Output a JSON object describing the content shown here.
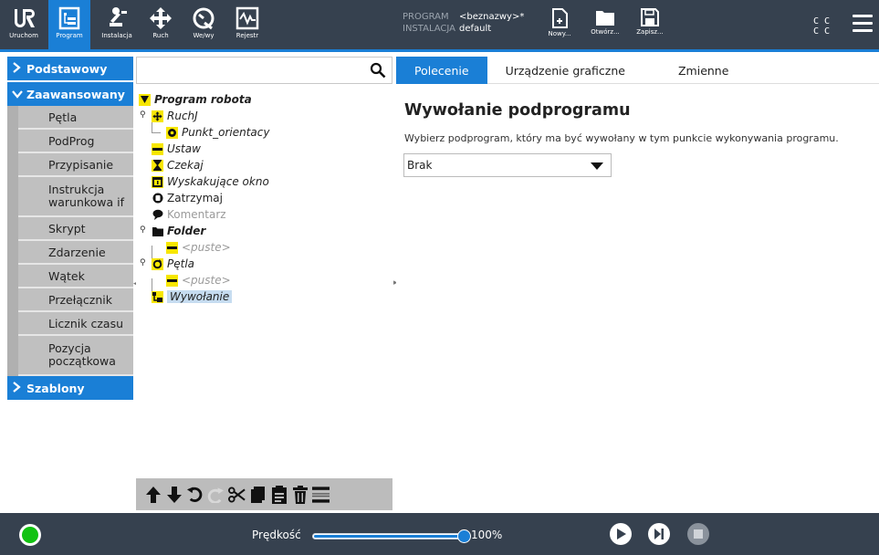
{
  "header": {
    "nav": [
      {
        "label": "Uruchom",
        "icon": "ur-logo-icon"
      },
      {
        "label": "Program",
        "icon": "program-tree-icon"
      },
      {
        "label": "Instalacja",
        "icon": "robot-arm-icon"
      },
      {
        "label": "Ruch",
        "icon": "move-arrows-icon"
      },
      {
        "label": "We/wy",
        "icon": "io-gauge-icon"
      },
      {
        "label": "Rejestr",
        "icon": "log-chart-icon"
      }
    ],
    "program_key": "PROGRAM",
    "program_value": "<beznazwy>*",
    "installation_key": "INSTALACJA",
    "installation_value": "default",
    "file_buttons": [
      {
        "label": "Nowy...",
        "icon": "new-file-icon"
      },
      {
        "label": "Otwórz...",
        "icon": "folder-open-icon"
      },
      {
        "label": "Zapisz...",
        "icon": "save-icon"
      }
    ],
    "cc_line1": "C C",
    "cc_line2": "C C"
  },
  "left_panel": {
    "categories": {
      "basic": "Podstawowy",
      "advanced": "Zaawansowany",
      "templates": "Szablony"
    },
    "advanced_items": [
      "Pętla",
      "PodProg",
      "Przypisanie",
      "Instrukcja warunkowa if",
      "Skrypt",
      "Zdarzenie",
      "Wątek",
      "Przełącznik",
      "Licznik czasu",
      "Pozycja początkowa"
    ]
  },
  "tree": {
    "search_placeholder": "",
    "nodes": {
      "root": "Program robota",
      "movej": "RuchJ",
      "waypoint": "Punkt_orientacy",
      "set": "Ustaw",
      "wait": "Czekaj",
      "popup": "Wyskakujące okno",
      "halt": "Zatrzymaj",
      "comment": "Komentarz",
      "folder": "Folder",
      "folder_empty": "<puste>",
      "loop": "Pętla",
      "loop_empty": "<puste>",
      "call": "Wywołanie"
    }
  },
  "right_panel": {
    "tabs": [
      "Polecenie",
      "Urządzenie graficzne",
      "Zmienne"
    ],
    "title": "Wywołanie podprogramu",
    "description": "Wybierz podprogram, który ma być wywołany w tym punkcie wykonywania programu.",
    "select_value": "Brak"
  },
  "footer": {
    "speed_label": "Prędkość",
    "speed_value": "100%",
    "speed_fraction": 1.0
  },
  "colors": {
    "header_bg": "#36414f",
    "accent": "#1a7fd6",
    "node_yellow": "#f7e600",
    "power_green": "#12c212"
  }
}
